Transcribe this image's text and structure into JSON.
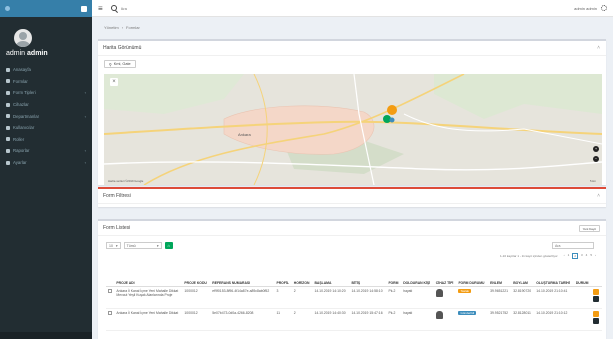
{
  "app": {
    "logo_text": "",
    "search_placeholder": "Ara",
    "top_user": "admin admin"
  },
  "sidebar": {
    "user_first": "admin",
    "user_last": "admin",
    "items": [
      {
        "label": "Anasayfa",
        "caret": ""
      },
      {
        "label": "Formlar",
        "caret": ""
      },
      {
        "label": "Form Tipleri",
        "caret": "‹"
      },
      {
        "label": "Cihazlar",
        "caret": ""
      },
      {
        "label": "Departmanlar",
        "caret": "‹"
      },
      {
        "label": "Kullanıcılar",
        "caret": ""
      },
      {
        "label": "Roller",
        "caret": ""
      },
      {
        "label": "Raporlar",
        "caret": "‹"
      },
      {
        "label": "Ayarlar",
        "caret": "‹"
      }
    ],
    "footer": ""
  },
  "breadcrumb": {
    "home": "Yönetim",
    "current": "Formlar"
  },
  "map_box": {
    "title": "Harita Görünümü",
    "button_label": "Kml, Gate",
    "city": "Ankara",
    "footer": "Harita verileri ©2019 Google",
    "scale": "5 km"
  },
  "filter_box": {
    "title": "Form Filtresi"
  },
  "list_box": {
    "title": "Form Listesi",
    "add_label": "Yeni Kayıt",
    "page_size": "10",
    "filter_select": "Tümü",
    "search_placeholder": "Ara",
    "info": "1-10 kayıtlar 1 - 11 kayıt içinden gösteriliyor",
    "pages": [
      "‹",
      "1",
      "2",
      "3",
      "4",
      "5",
      "›"
    ],
    "active_page": "2",
    "columns": [
      "",
      "PROJE ADI",
      "PROJE KODU",
      "REFERANS NUMARASI",
      "PROFİL",
      "HORİZON",
      "BAŞLAMA",
      "BİTİŞ",
      "FORM",
      "DOLDURAN KİŞİ",
      "CİHAZ TİPİ",
      "FORM DURUMU",
      "ENLEM",
      "BOYLAM",
      "OLUŞTURMA TARİHİ",
      "DURUM",
      ""
    ],
    "rows": [
      {
        "project": "Ankara İl Kanal İçme Yeni Mahalle Dikkat Mevcut Yeşil Kuşak Alanlarında Proje",
        "code": "1000012",
        "ref": "ef9f0153-8f96-4f14a87e-a89c8ab0f52",
        "profile": "3",
        "horizon": "2",
        "start": "14.10.2019 14:10:20",
        "end": "14.10.2019 14:58:10",
        "form": "Pk-2",
        "filler": "hayati",
        "status_text": "Taslak",
        "status_color": "#f39c12",
        "lat": "39.9651221",
        "lng": "32.8190720",
        "created": "14.10.2019 21:10:41"
      },
      {
        "project": "Ankara İl Kanal İçme Yeni Mahalle Dikkat",
        "code": "1000012",
        "ref": "5e07b473-0d0a-4266-8208",
        "profile": "11",
        "horizon": "2",
        "start": "14.10.2019 14:40:30",
        "end": "14.10.2019 15:47:16",
        "form": "Pk-2",
        "filler": "hayati",
        "status_text": "Gönderildi",
        "status_color": "#3c8dbc",
        "lat": "39.9521752",
        "lng": "32.8128011",
        "created": "14.10.2019 21:10:12"
      }
    ]
  },
  "colors": {
    "sidebar_bg": "#222d32",
    "logo_bg": "#367fa9",
    "green": "#00a65a",
    "orange": "#f39c12",
    "blue": "#3c8dbc",
    "red": "#dd4b39"
  }
}
